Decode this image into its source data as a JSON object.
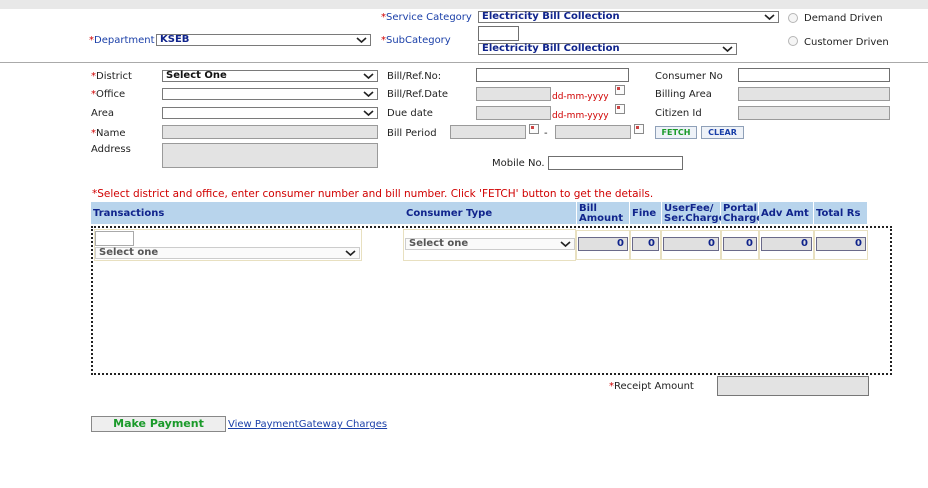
{
  "header": {
    "service_category_label": "Service Category",
    "service_category_value": "Electricity Bill Collection",
    "department_label": "Department",
    "department_value": "KSEB",
    "subcategory_label": "SubCategory",
    "subcategory_value": "Electricity Bill Collection",
    "radio_demand": "Demand Driven",
    "radio_customer": "Customer Driven"
  },
  "form": {
    "district_label": "District",
    "district_value": "Select One",
    "office_label": "Office",
    "office_value": "",
    "area_label": "Area",
    "area_value": "",
    "name_label": "Name",
    "address_label": "Address",
    "bill_ref_no_label": "Bill/Ref.No:",
    "bill_ref_date_label": "Bill/Ref.Date",
    "due_date_label": "Due date",
    "bill_period_label": "Bill Period",
    "date_hint": "dd-mm-yyyy",
    "period_separator": "-",
    "consumer_no_label": "Consumer No",
    "billing_area_label": "Billing Area",
    "citizen_id_label": "Citizen Id",
    "fetch_label": "FETCH",
    "clear_label": "CLEAR",
    "mobile_label": "Mobile No."
  },
  "instruction": "*Select district and office, enter consumer number and bill number. Click 'FETCH' button to get the details.",
  "table": {
    "headers": {
      "transactions": "Transactions",
      "consumer_type": "Consumer Type",
      "bill_amount": "Bill Amount",
      "fine": "Fine",
      "userfee": "UserFee/ Ser.Charge",
      "portal_charge": "Portal Charge",
      "adv_amt": "Adv Amt",
      "total": "Total Rs"
    },
    "row": {
      "transaction_select": "Select one",
      "consumer_type_select": "Select one",
      "bill_amount": "0",
      "fine": "0",
      "userfee": "0",
      "portal_charge": "0",
      "adv_amt": "0",
      "total": "0"
    }
  },
  "footer": {
    "receipt_amount_label": "Receipt Amount",
    "make_payment_label": "Make Payment",
    "view_charges_link": "View PaymentGateway Charges"
  },
  "colors": {
    "label_blue": "#10248c",
    "required_red": "#d00000",
    "header_bg": "#b8d4ec",
    "button_green": "#1a9a2a"
  }
}
